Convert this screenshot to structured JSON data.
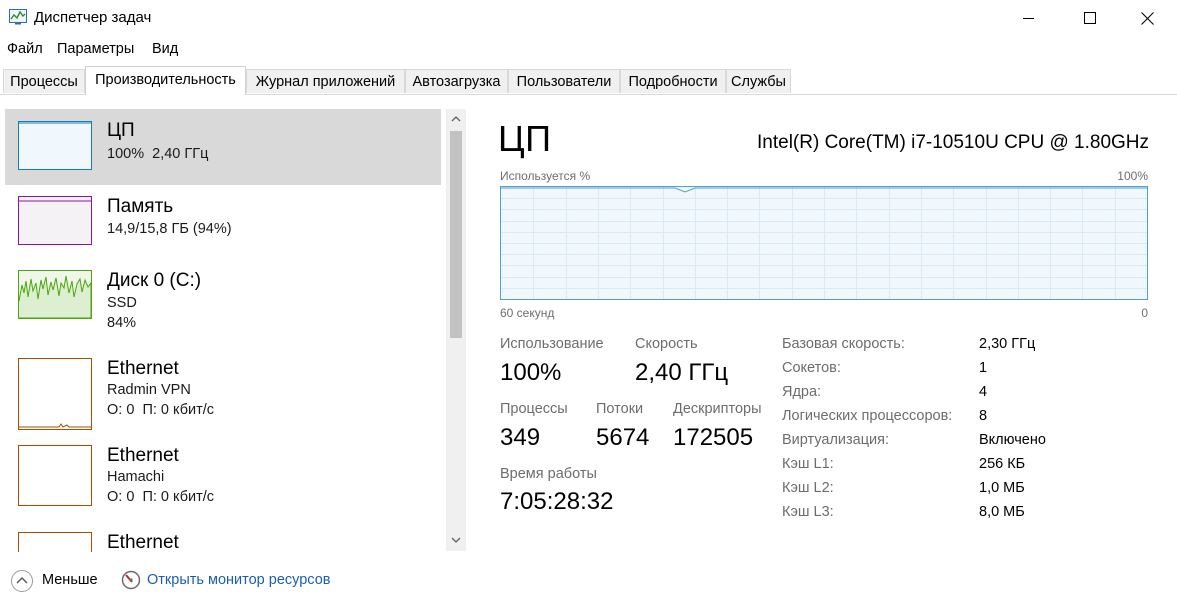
{
  "window": {
    "title": "Диспетчер задач",
    "minimize": "minimize",
    "maximize": "maximize",
    "close": "close"
  },
  "menu": [
    "Файл",
    "Параметры",
    "Вид"
  ],
  "tabs": [
    {
      "label": "Процессы"
    },
    {
      "label": "Производительность"
    },
    {
      "label": "Журнал приложений"
    },
    {
      "label": "Автозагрузка"
    },
    {
      "label": "Пользователи"
    },
    {
      "label": "Подробности"
    },
    {
      "label": "Службы"
    }
  ],
  "sidebar": {
    "items": [
      {
        "title": "ЦП",
        "lines": [
          "100%  2,40 ГГц"
        ],
        "color": "#117dbb"
      },
      {
        "title": "Память",
        "lines": [
          "14,9/15,8 ГБ (94%)"
        ],
        "color": "#8b12ae"
      },
      {
        "title": "Диск 0 (C:)",
        "lines": [
          "SSD",
          "84%"
        ],
        "color": "#4da60c"
      },
      {
        "title": "Ethernet",
        "lines": [
          "Radmin VPN",
          "О: 0  П: 0 кбит/с"
        ],
        "color": "#a74f01"
      },
      {
        "title": "Ethernet",
        "lines": [
          "Hamachi",
          "О: 0  П: 0 кбит/с"
        ],
        "color": "#a74f01"
      },
      {
        "title": "Ethernet",
        "lines": [],
        "color": "#a74f01"
      }
    ]
  },
  "main": {
    "title": "ЦП",
    "model": "Intel(R) Core(TM) i7-10510U CPU @ 1.80GHz",
    "graph": {
      "top_left": "Используется %",
      "top_right": "100%",
      "bottom_left": "60 секунд",
      "bottom_right": "0",
      "usage_percent": 100,
      "line_color": "#4ea1d6"
    },
    "stats": {
      "usage_label": "Использование",
      "usage_value": "100%",
      "speed_label": "Скорость",
      "speed_value": "2,40 ГГц",
      "processes_label": "Процессы",
      "processes_value": "349",
      "threads_label": "Потоки",
      "threads_value": "5674",
      "handles_label": "Дескрипторы",
      "handles_value": "172505",
      "uptime_label": "Время работы",
      "uptime_value": "7:05:28:32"
    },
    "properties": [
      {
        "label": "Базовая скорость:",
        "value": "2,30 ГГц"
      },
      {
        "label": "Сокетов:",
        "value": "1"
      },
      {
        "label": "Ядра:",
        "value": "4"
      },
      {
        "label": "Логических процессоров:",
        "value": "8"
      },
      {
        "label": "Виртуализация:",
        "value": "Включено"
      },
      {
        "label": "Кэш L1:",
        "value": "256 КБ"
      },
      {
        "label": "Кэш L2:",
        "value": "1,0 МБ"
      },
      {
        "label": "Кэш L3:",
        "value": "8,0 МБ"
      }
    ]
  },
  "footer": {
    "less_label": "Меньше",
    "resource_monitor_label": "Открыть монитор ресурсов"
  }
}
